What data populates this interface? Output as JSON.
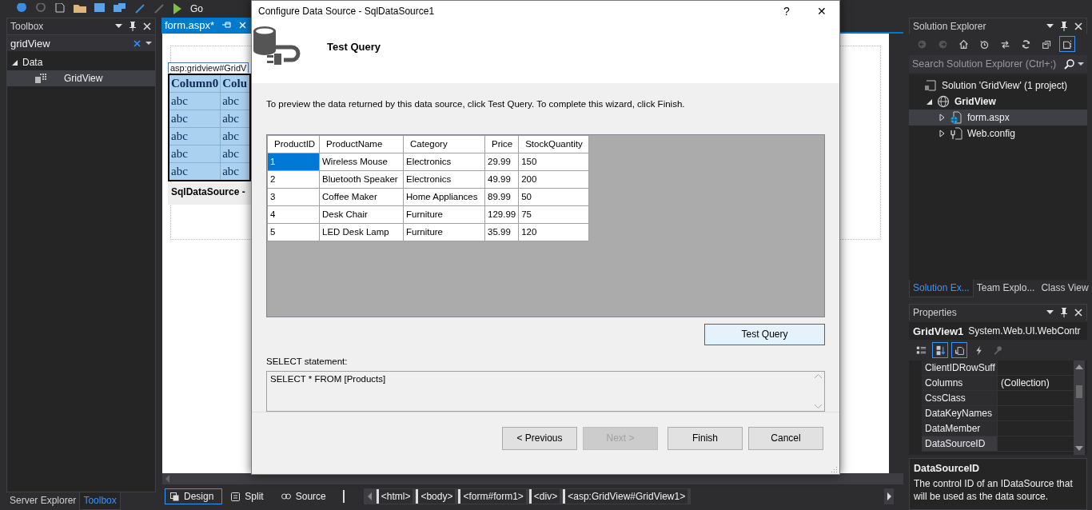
{
  "toolbar": {
    "run_label": "Go"
  },
  "toolbox": {
    "title": "Toolbox",
    "search": "gridView",
    "tree": [
      {
        "label": "Data",
        "expanded": true,
        "selected": false,
        "children": [
          {
            "label": "GridView",
            "selected": true
          }
        ]
      }
    ],
    "tabs": [
      {
        "label": "Server Explorer",
        "selected": false
      },
      {
        "label": "Toolbox",
        "selected": true
      }
    ]
  },
  "document_tabs": [
    {
      "label": "form.aspx*",
      "selected": true
    }
  ],
  "designer": {
    "grid_tag": "asp:gridview#GridV",
    "columns": [
      "Column0",
      "Colu"
    ],
    "rows": [
      [
        "abc",
        "abc"
      ],
      [
        "abc",
        "abc"
      ],
      [
        "abc",
        "abc"
      ],
      [
        "abc",
        "abc"
      ],
      [
        "abc",
        "abc"
      ]
    ],
    "datasource_label": "SqlDataSource -"
  },
  "view_tabs": [
    {
      "label": "Design",
      "kind": "design",
      "selected": true
    },
    {
      "label": "Split",
      "kind": "split",
      "selected": false
    },
    {
      "label": "Source",
      "kind": "source",
      "selected": false
    }
  ],
  "breadcrumb": [
    "<html>",
    "<body>",
    "<form#form1>",
    "<div>",
    "<asp:GridView#GridView1>"
  ],
  "solution_explorer": {
    "title": "Solution Explorer",
    "toolbar": [
      {
        "kind": "back",
        "selected": false
      },
      {
        "kind": "forward",
        "selected": false
      },
      {
        "kind": "home",
        "selected": false
      },
      {
        "kind": "history",
        "selected": false
      },
      {
        "kind": "sync",
        "selected": false
      },
      {
        "kind": "refresh",
        "selected": false
      },
      {
        "kind": "collapse",
        "selected": false
      },
      {
        "kind": "show-all",
        "selected": true
      }
    ],
    "search_placeholder": "Search Solution Explorer (Ctrl+;)",
    "tree": [
      {
        "label": "Solution 'GridView' (1 project)",
        "kind": "solution",
        "selected": false,
        "children": [
          {
            "label": "GridView",
            "kind": "project",
            "expanded": true,
            "selected": false,
            "children": [
              {
                "label": "form.aspx",
                "kind": "page",
                "expanded": false,
                "selected": true
              },
              {
                "label": "Web.config",
                "kind": "config",
                "expanded": false,
                "selected": false
              }
            ]
          }
        ]
      }
    ],
    "tabs": [
      {
        "label": "Solution Ex...",
        "selected": true
      },
      {
        "label": "Team Explo...",
        "selected": false
      },
      {
        "label": "Class View",
        "selected": false
      }
    ]
  },
  "properties": {
    "title": "Properties",
    "object": "GridView1",
    "type": "System.Web.UI.WebContr",
    "toolbar": [
      {
        "kind": "categorized",
        "selected": false
      },
      {
        "kind": "alphabetical",
        "selected": true
      },
      {
        "kind": "properties",
        "selected": true
      },
      {
        "kind": "events",
        "selected": false
      },
      {
        "kind": "pages",
        "selected": false
      }
    ],
    "rows": [
      {
        "name": "ClientIDRowSuff",
        "value": "",
        "selected": false
      },
      {
        "name": "Columns",
        "value": "(Collection)",
        "selected": false
      },
      {
        "name": "CssClass",
        "value": "",
        "selected": false
      },
      {
        "name": "DataKeyNames",
        "value": "",
        "selected": false
      },
      {
        "name": "DataMember",
        "value": "",
        "selected": false
      },
      {
        "name": "DataSourceID",
        "value": "",
        "selected": true
      }
    ],
    "description_title": "DataSourceID",
    "description": "The control ID of an IDataSource that will be used as the data source."
  },
  "dialog": {
    "title": "Configure Data Source - SqlDataSource1",
    "help_glyph": "?",
    "close_glyph": "✕",
    "heading": "Test Query",
    "intro": "To preview the data returned by this data source, click Test Query. To complete this wizard, click Finish.",
    "columns": [
      "ProductID",
      "ProductName",
      "Category",
      "Price",
      "StockQuantity"
    ],
    "rows": [
      {
        "selected": true,
        "cells": [
          "1",
          "Wireless Mouse",
          "Electronics",
          "29.99",
          "150"
        ]
      },
      {
        "selected": false,
        "cells": [
          "2",
          "Bluetooth Speaker",
          "Electronics",
          "49.99",
          "200"
        ]
      },
      {
        "selected": false,
        "cells": [
          "3",
          "Coffee Maker",
          "Home Appliances",
          "89.99",
          "50"
        ]
      },
      {
        "selected": false,
        "cells": [
          "4",
          "Desk Chair",
          "Furniture",
          "129.99",
          "75"
        ]
      },
      {
        "selected": false,
        "cells": [
          "5",
          "LED Desk Lamp",
          "Furniture",
          "35.99",
          "120"
        ]
      }
    ],
    "test_button": {
      "label": "Test Query",
      "focused": true
    },
    "statement_label": "SELECT statement:",
    "statement": "SELECT * FROM [Products]",
    "buttons": [
      {
        "label": "< Previous",
        "disabled": false
      },
      {
        "label": "Next >",
        "disabled": true
      },
      {
        "label": "Finish",
        "disabled": false
      },
      {
        "label": "Cancel",
        "disabled": false
      }
    ]
  }
}
